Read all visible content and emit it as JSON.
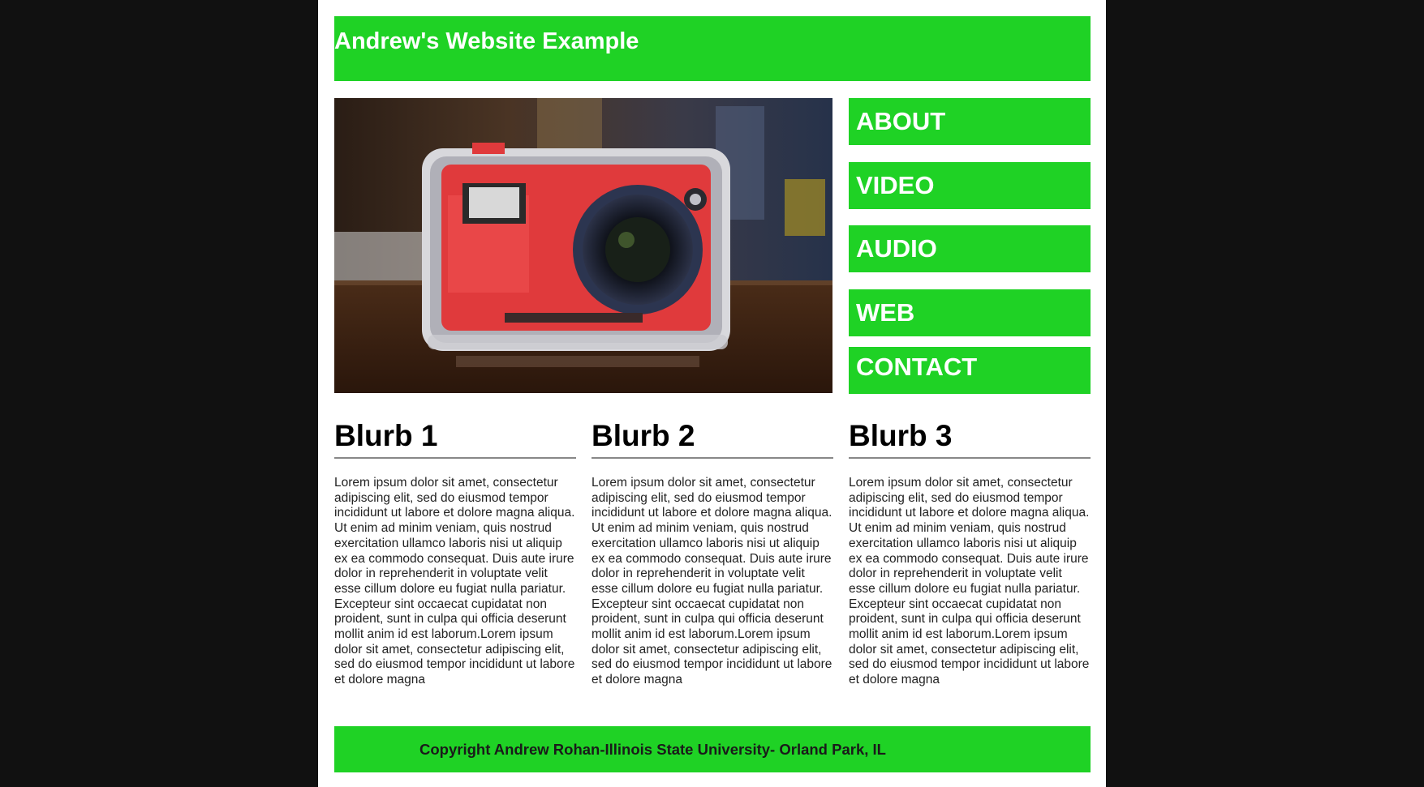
{
  "colors": {
    "accent": "#1fd225",
    "background": "#111111",
    "page": "#ffffff"
  },
  "header": {
    "title": "Andrew's Website Example"
  },
  "hero": {
    "image": "handmade-camera-photo"
  },
  "nav": {
    "items": [
      {
        "label": "ABOUT"
      },
      {
        "label": "VIDEO"
      },
      {
        "label": "AUDIO"
      },
      {
        "label": "WEB"
      },
      {
        "label": "CONTACT"
      }
    ]
  },
  "blurbs": [
    {
      "title": "Blurb 1",
      "text": "Lorem ipsum dolor sit amet, consectetur adipiscing elit, sed do eiusmod tempor incididunt ut labore et dolore magna aliqua. Ut enim ad minim veniam, quis nostrud exercitation ullamco laboris nisi ut aliquip ex ea commodo consequat. Duis aute irure dolor in reprehenderit in voluptate velit esse cillum dolore eu fugiat nulla pariatur. Excepteur sint occaecat cupidatat non proident, sunt in culpa qui officia deserunt mollit anim id est laborum.Lorem ipsum dolor sit amet, consectetur adipiscing elit, sed do eiusmod tempor incididunt ut labore et dolore magna"
    },
    {
      "title": "Blurb 2",
      "text": "Lorem ipsum dolor sit amet, consectetur adipiscing elit, sed do eiusmod tempor incididunt ut labore et dolore magna aliqua. Ut enim ad minim veniam, quis nostrud exercitation ullamco laboris nisi ut aliquip ex ea commodo consequat. Duis aute irure dolor in reprehenderit in voluptate velit esse cillum dolore eu fugiat nulla pariatur. Excepteur sint occaecat cupidatat non proident, sunt in culpa qui officia deserunt mollit anim id est laborum.Lorem ipsum dolor sit amet, consectetur adipiscing elit, sed do eiusmod tempor incididunt ut labore et dolore magna"
    },
    {
      "title": "Blurb 3",
      "text": "Lorem ipsum dolor sit amet, consectetur adipiscing elit, sed do eiusmod tempor incididunt ut labore et dolore magna aliqua. Ut enim ad minim veniam, quis nostrud exercitation ullamco laboris nisi ut aliquip ex ea commodo consequat. Duis aute irure dolor in reprehenderit in voluptate velit esse cillum dolore eu fugiat nulla pariatur. Excepteur sint occaecat cupidatat non proident, sunt in culpa qui officia deserunt mollit anim id est laborum.Lorem ipsum dolor sit amet, consectetur adipiscing elit, sed do eiusmod tempor incididunt ut labore et dolore magna"
    }
  ],
  "footer": {
    "text": "Copyright Andrew Rohan-Illinois State University- Orland Park, IL"
  }
}
